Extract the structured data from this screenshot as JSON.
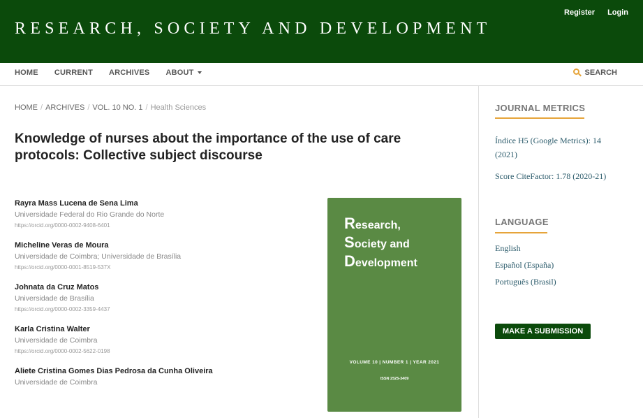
{
  "header": {
    "site_title": "RESEARCH, SOCIETY AND DEVELOPMENT",
    "register_label": "Register",
    "login_label": "Login",
    "background_color": "#0b4a0b"
  },
  "nav": {
    "items": [
      "HOME",
      "CURRENT",
      "ARCHIVES",
      "ABOUT"
    ],
    "search_label": "SEARCH",
    "search_icon": "search-icon"
  },
  "breadcrumb": {
    "home": "HOME",
    "archives": "ARCHIVES",
    "issue": "VOL. 10 NO. 1",
    "section": "Health Sciences"
  },
  "article": {
    "title": "Knowledge of nurses about the importance of the use of care protocols: Collective subject discourse",
    "authors": [
      {
        "name": "Rayra Mass Lucena de Sena Lima",
        "affiliation": "Universidade Federal do Rio Grande do Norte",
        "orcid": "https://orcid.org/0000-0002-9408-6401"
      },
      {
        "name": "Micheline Veras de Moura",
        "affiliation": "Universidade de Coimbra; Universidade de Brasília",
        "orcid": "https://orcid.org/0000-0001-8519-537X"
      },
      {
        "name": "Johnata da Cruz Matos",
        "affiliation": "Universidade de Brasília",
        "orcid": "https://orcid.org/0000-0002-3359-4437"
      },
      {
        "name": "Karla Cristina Walter",
        "affiliation": "Universidade de Coimbra",
        "orcid": "https://orcid.org/0000-0002-5622-0198"
      },
      {
        "name": "Aliete Cristina Gomes Dias Pedrosa da Cunha Oliveira",
        "affiliation": "Universidade de Coimbra",
        "orcid": ""
      }
    ]
  },
  "cover": {
    "line1_initial": "R",
    "line1_rest": "esearch,",
    "line2_initial": "S",
    "line2_rest": "ociety and",
    "line3_initial": "D",
    "line3_rest": "evelopment",
    "volume_line": "VOLUME 10 | NUMBER 1 | YEAR 2021",
    "issn": "ISSN 2525-3409",
    "background_color": "#5a8a44"
  },
  "sidebar": {
    "metrics_title": "JOURNAL METRICS",
    "metric_h5_line1": "Índice H5 (Google Metrics): 14",
    "metric_h5_line2": "(2021)",
    "metric_citefactor": "Score CiteFactor: 1.78 (2020-21)",
    "language_title": "LANGUAGE",
    "languages": [
      "English",
      "Español (España)",
      "Português (Brasil)"
    ],
    "submit_label": "MAKE A SUBMISSION",
    "accent_color": "#e6a43a"
  }
}
